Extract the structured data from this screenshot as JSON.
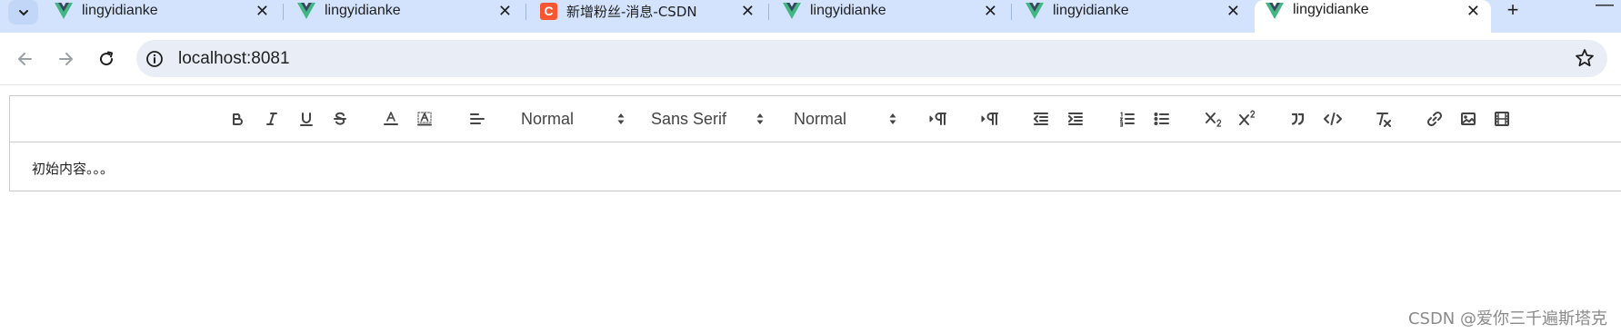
{
  "tabs": [
    {
      "title": "lingyidianke",
      "favicon": "vue-logo-icon",
      "close": "✕"
    },
    {
      "title": "lingyidianke",
      "favicon": "vue-logo-icon",
      "close": "✕"
    },
    {
      "title": "新增粉丝-消息-CSDN",
      "favicon": "csdn-logo-icon",
      "favicon_letter": "C",
      "close": "✕"
    },
    {
      "title": "lingyidianke",
      "favicon": "vue-logo-icon",
      "close": "✕"
    },
    {
      "title": "lingyidianke",
      "favicon": "vue-logo-icon",
      "close": "✕"
    },
    {
      "title": "lingyidianke",
      "favicon": "vue-logo-icon",
      "close": "✕",
      "active": true
    }
  ],
  "new_tab_label": "+",
  "minimize_label": "—",
  "address_bar": {
    "url": "localhost:8081"
  },
  "editor": {
    "toolbar": {
      "header_picker": "Normal",
      "font_picker": "Sans Serif",
      "size_picker": "Normal",
      "buttons": [
        "bold",
        "italic",
        "underline",
        "strike",
        "color",
        "background",
        "align",
        "ltr",
        "rtl",
        "outdent",
        "indent",
        "ordered-list",
        "bullet-list",
        "subscript",
        "superscript",
        "blockquote",
        "code-block",
        "clean",
        "link",
        "image",
        "video"
      ]
    },
    "content": "初始内容。。。"
  },
  "watermark": "CSDN @爱你三千遍斯塔克",
  "colors": {
    "tabstrip": "#d3e3fd",
    "omnibox": "#e9eef6",
    "vue_green": "#41b883",
    "vue_dark": "#35495e",
    "csdn_red": "#fc5531"
  }
}
